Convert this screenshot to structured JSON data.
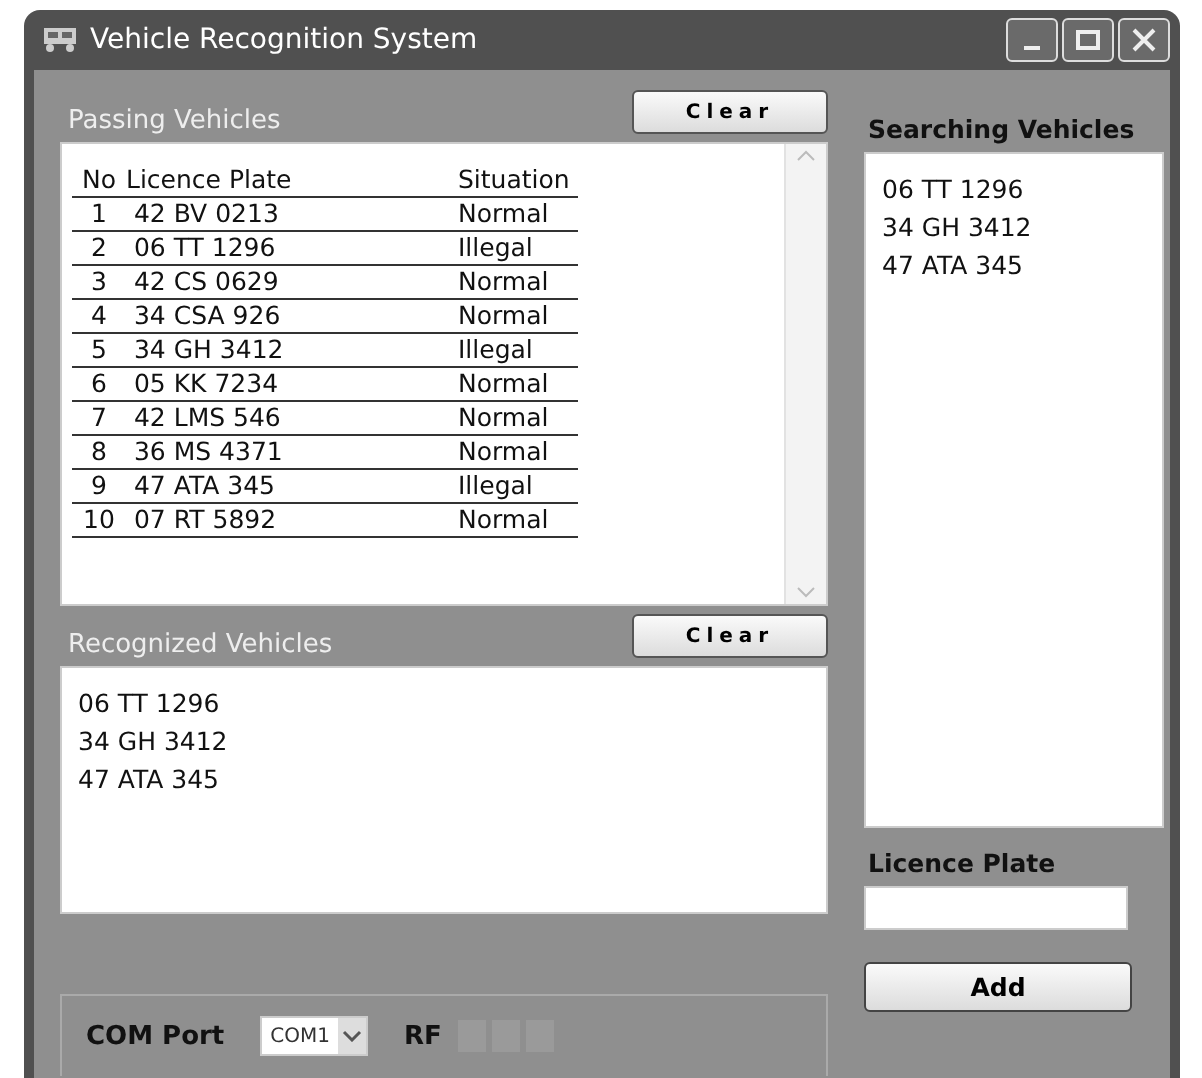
{
  "window": {
    "title": "Vehicle Recognition System"
  },
  "passing": {
    "label": "Passing Vehicles",
    "clear_button": "Clear",
    "columns": [
      "No",
      "Licence Plate",
      "Situation"
    ],
    "rows": [
      {
        "no": "1",
        "plate": "42 BV 0213",
        "situation": "Normal"
      },
      {
        "no": "2",
        "plate": "06 TT 1296",
        "situation": "Illegal"
      },
      {
        "no": "3",
        "plate": "42 CS 0629",
        "situation": "Normal"
      },
      {
        "no": "4",
        "plate": "34 CSA 926",
        "situation": "Normal"
      },
      {
        "no": "5",
        "plate": "34 GH 3412",
        "situation": "Illegal"
      },
      {
        "no": "6",
        "plate": "05 KK 7234",
        "situation": "Normal"
      },
      {
        "no": "7",
        "plate": "42 LMS 546",
        "situation": "Normal"
      },
      {
        "no": "8",
        "plate": "36 MS 4371",
        "situation": "Normal"
      },
      {
        "no": "9",
        "plate": "47 ATA 345",
        "situation": "Illegal"
      },
      {
        "no": "10",
        "plate": "07 RT 5892",
        "situation": "Normal"
      }
    ]
  },
  "recognized": {
    "label": "Recognized Vehicles",
    "clear_button": "Clear",
    "items": [
      "06 TT 1296",
      "34 GH 3412",
      "47 ATA 345"
    ]
  },
  "status": {
    "com_label": "COM Port",
    "com_value": "COM1",
    "rf_label": "RF",
    "rf_indicators": [
      {
        "on": false
      },
      {
        "on": false
      },
      {
        "on": false
      }
    ]
  },
  "searching": {
    "label": "Searching Vehicles",
    "items": [
      "06 TT 1296",
      "34 GH 3412",
      "47 ATA 345"
    ]
  },
  "add_form": {
    "label": "Licence Plate",
    "button": "Add"
  }
}
